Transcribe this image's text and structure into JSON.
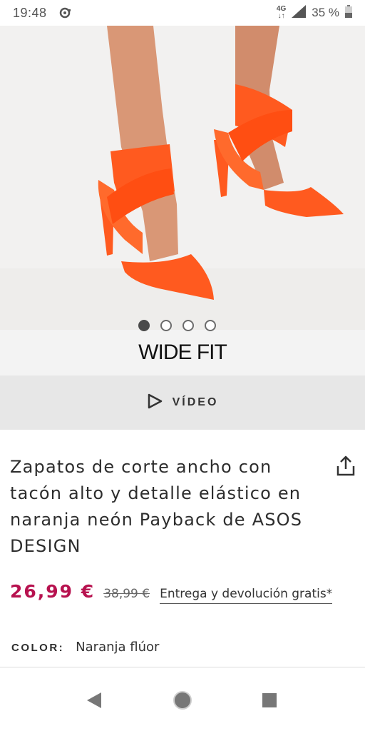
{
  "status_bar": {
    "time": "19:48",
    "network_type": "4G",
    "battery": "35 %",
    "icons": [
      "notification-icon",
      "signal-icon",
      "battery-icon"
    ]
  },
  "gallery": {
    "image_alt": "Orange neon high heel shoes with elastic straps",
    "slide_count": 4,
    "active_slide": 1
  },
  "badge": {
    "wide_fit": "WIDE FIT"
  },
  "video_button": {
    "label": "VÍDEO",
    "icon": "play-icon"
  },
  "product": {
    "title": "Zapatos de corte ancho con tacón alto y detalle elástico en naranja neón Payback de ASOS DESIGN",
    "price_current": "26,99 €",
    "price_previous": "38,99 €",
    "delivery_link": "Entrega y devolución gratis*",
    "color_label": "COLOR:",
    "color_value": "Naranja flúor"
  },
  "colors": {
    "price_accent": "#b7124f",
    "shoe_orange": "#ff5a1f"
  },
  "nav_bar": {
    "buttons": [
      "back-icon",
      "home-icon",
      "recents-icon"
    ]
  }
}
